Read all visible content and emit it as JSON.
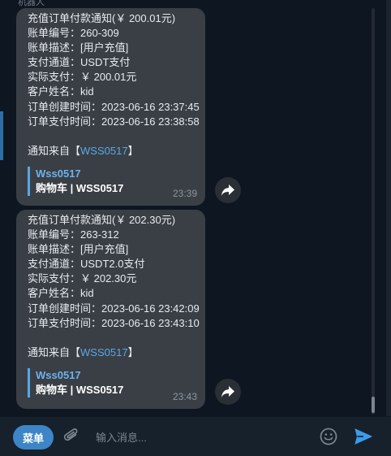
{
  "top_hint": "机器人",
  "messages": [
    {
      "lines": [
        "充值订单付款通知(￥ 200.01元)",
        "账单编号：260-309",
        "账单描述：[用户充值]",
        "支付通道：USDT支付",
        "实际支付：￥ 200.01元",
        "客户姓名：kid",
        "订单创建时间：2023-06-16 23:37:45",
        "订单支付时间：2023-06-16 23:38:58"
      ],
      "source_prefix": "通知来自【",
      "source_link": "WSS0517",
      "source_suffix": "】",
      "reply_name": "Wss0517",
      "reply_text": "购物车 | WSS0517",
      "time": "23:39"
    },
    {
      "lines": [
        "充值订单付款通知(￥ 202.30元)",
        "账单编号：263-312",
        "账单描述：[用户充值]",
        "支付通道：USDT2.0支付",
        "实际支付：￥ 202.30元",
        "客户姓名：kid",
        "订单创建时间：2023-06-16 23:42:09",
        "订单支付时间：2023-06-16 23:43:10"
      ],
      "source_prefix": "通知来自【",
      "source_link": "WSS0517",
      "source_suffix": "】",
      "reply_name": "Wss0517",
      "reply_text": "购物车 | WSS0517",
      "time": "23:43"
    }
  ],
  "composer": {
    "menu_label": "菜单",
    "placeholder": "输入消息..."
  },
  "colors": {
    "accent": "#3d85c6",
    "link": "#5aa7e6",
    "bubble": "#3a3f45",
    "background": "#0e1621"
  }
}
